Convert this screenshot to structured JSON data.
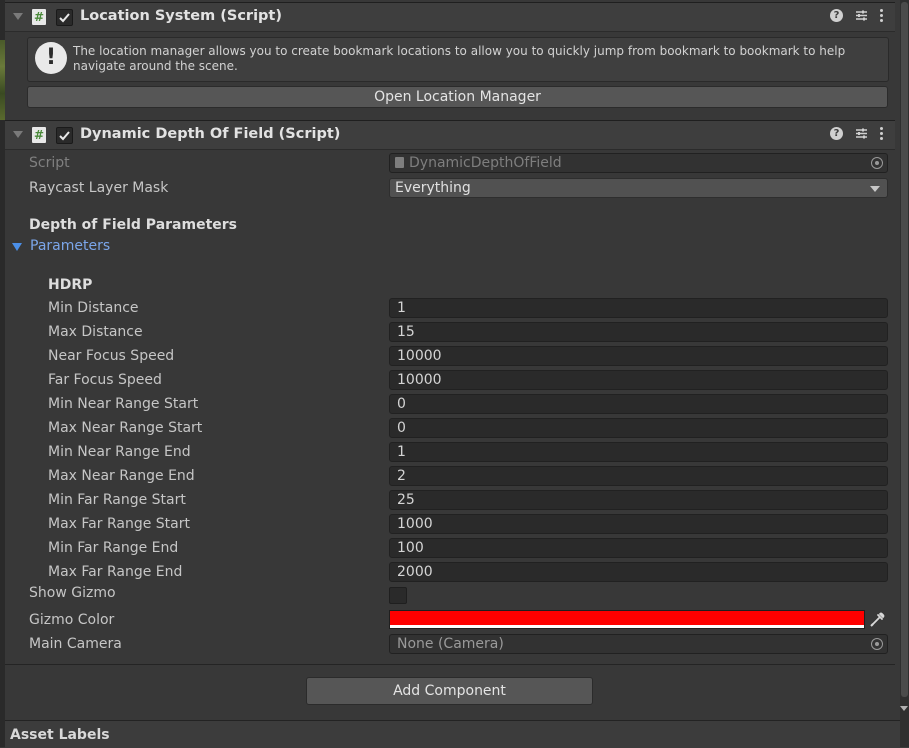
{
  "location_component": {
    "title": "Location System (Script)",
    "help_text": "The location manager allows you to create bookmark locations to allow you to quickly jump from bookmark to bookmark to help navigate around the scene.",
    "open_button": "Open Location Manager"
  },
  "dof_component": {
    "title": "Dynamic Depth Of Field (Script)",
    "script_label": "Script",
    "script_value": "DynamicDepthOfField",
    "raycast_label": "Raycast Layer Mask",
    "raycast_value": "Everything",
    "section_header": "Depth of Field Parameters",
    "parameters_foldout": "Parameters",
    "hdrp_header": "HDRP",
    "params": [
      {
        "label": "Min Distance",
        "value": "1"
      },
      {
        "label": "Max Distance",
        "value": "15"
      },
      {
        "label": "Near Focus Speed",
        "value": "10000"
      },
      {
        "label": "Far Focus Speed",
        "value": "10000"
      },
      {
        "label": "Min Near Range Start",
        "value": "0"
      },
      {
        "label": "Max Near Range Start",
        "value": "0"
      },
      {
        "label": "Min Near Range End",
        "value": "1"
      },
      {
        "label": "Max Near Range End",
        "value": "2"
      },
      {
        "label": "Min Far Range Start",
        "value": "25"
      },
      {
        "label": "Max Far Range Start",
        "value": "1000"
      },
      {
        "label": "Min Far Range End",
        "value": "100"
      },
      {
        "label": "Max Far Range End",
        "value": "2000"
      }
    ],
    "show_gizmo_label": "Show Gizmo",
    "show_gizmo_checked": false,
    "gizmo_color_label": "Gizmo Color",
    "gizmo_color": "#ff0000",
    "main_camera_label": "Main Camera",
    "main_camera_value": "None (Camera)"
  },
  "add_component_button": "Add Component",
  "asset_labels": "Asset Labels",
  "icons": {
    "script": "script-hash-icon",
    "help": "help-icon",
    "preset": "preset-sliders-icon",
    "menu": "kebab-menu-icon",
    "info": "info-icon",
    "eyedropper": "eyedropper-icon",
    "object_picker": "object-picker-icon"
  },
  "colors": {
    "panel_bg": "#383838",
    "field_bg": "#2a2a2a",
    "accent_blue": "#4b8fe8"
  }
}
